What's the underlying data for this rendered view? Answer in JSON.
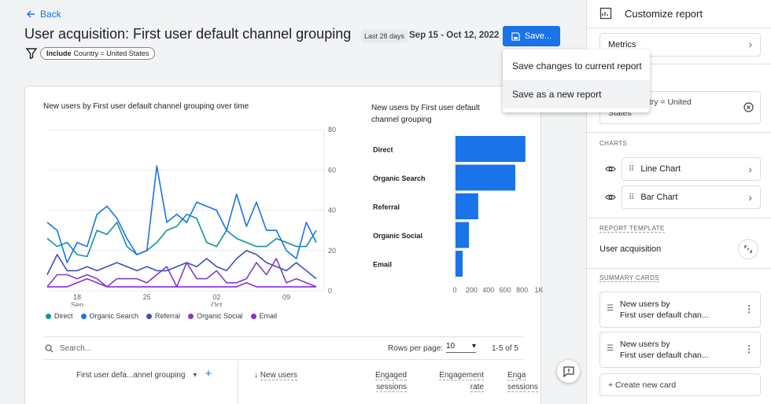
{
  "header": {
    "back_label": "Back",
    "title": "User acquisition: First user default channel grouping",
    "filter_include": "Include",
    "filter_text": "Country = United States",
    "date_label": "Last 28 days",
    "date_range": "Sep 15 - Oct 12, 2022",
    "save_label": "Save..."
  },
  "save_menu": {
    "items": [
      "Save changes to current report",
      "Save as a new report"
    ]
  },
  "line_chart": {
    "title": "New users by First user default channel grouping over time",
    "y_ticks": [
      "80",
      "60",
      "40",
      "20",
      "0"
    ],
    "x_ticks": [
      {
        "day": "18",
        "month": "Sep"
      },
      {
        "day": "25",
        "month": ""
      },
      {
        "day": "02",
        "month": "Oct"
      },
      {
        "day": "09",
        "month": ""
      }
    ]
  },
  "bar_chart": {
    "title": "New users by First user default channel grouping",
    "x_ticks": [
      "0",
      "200",
      "400",
      "600",
      "800",
      "1K"
    ]
  },
  "chart_data": [
    {
      "type": "line",
      "title": "New users by First user default channel grouping over time",
      "x": [
        "Sep 15",
        "Sep 16",
        "Sep 17",
        "Sep 18",
        "Sep 19",
        "Sep 20",
        "Sep 21",
        "Sep 22",
        "Sep 23",
        "Sep 24",
        "Sep 25",
        "Sep 26",
        "Sep 27",
        "Sep 28",
        "Sep 29",
        "Sep 30",
        "Oct 1",
        "Oct 2",
        "Oct 3",
        "Oct 4",
        "Oct 5",
        "Oct 6",
        "Oct 7",
        "Oct 8",
        "Oct 9",
        "Oct 10",
        "Oct 11",
        "Oct 12"
      ],
      "ylim": [
        0,
        80
      ],
      "series": [
        {
          "name": "Direct",
          "color": "#12939a",
          "values": [
            26,
            22,
            24,
            18,
            17,
            30,
            28,
            34,
            22,
            18,
            20,
            24,
            30,
            32,
            38,
            36,
            24,
            22,
            30,
            26,
            24,
            22,
            22,
            26,
            24,
            22,
            22,
            30
          ]
        },
        {
          "name": "Organic Search",
          "color": "#1a73e8",
          "values": [
            34,
            30,
            14,
            24,
            22,
            38,
            42,
            36,
            26,
            18,
            20,
            62,
            34,
            38,
            34,
            44,
            42,
            40,
            30,
            48,
            32,
            44,
            30,
            30,
            20,
            16,
            34,
            24
          ]
        },
        {
          "name": "Referral",
          "color": "#3f51b5",
          "values": [
            8,
            18,
            10,
            10,
            12,
            10,
            12,
            14,
            12,
            10,
            12,
            10,
            10,
            12,
            14,
            12,
            16,
            12,
            10,
            16,
            20,
            18,
            14,
            12,
            10,
            14,
            10,
            6
          ]
        },
        {
          "name": "Organic Social",
          "color": "#7e3ec3",
          "values": [
            2,
            8,
            8,
            6,
            8,
            6,
            2,
            6,
            6,
            6,
            4,
            8,
            12,
            2,
            14,
            6,
            6,
            10,
            4,
            4,
            6,
            14,
            8,
            16,
            4,
            6,
            4,
            2
          ]
        },
        {
          "name": "Email",
          "color": "#8a2be2",
          "values": [
            2,
            2,
            2,
            4,
            6,
            4,
            2,
            2,
            2,
            2,
            2,
            2,
            2,
            2,
            2,
            2,
            2,
            2,
            2,
            2,
            4,
            2,
            2,
            2,
            2,
            2,
            2,
            2
          ]
        }
      ]
    },
    {
      "type": "bar",
      "title": "New users by First user default channel grouping",
      "categories": [
        "Direct",
        "Organic Search",
        "Referral",
        "Organic Social",
        "Email"
      ],
      "values": [
        830,
        710,
        270,
        160,
        85
      ],
      "xlim": [
        0,
        1000
      ],
      "color": "#1a73e8"
    }
  ],
  "table": {
    "search_placeholder": "Search...",
    "rows_label": "Rows per page:",
    "rows_value": "10",
    "pager": "1-5 of 5",
    "dim_header": "First user defa...annel grouping",
    "columns": [
      {
        "line1": "New users",
        "line2": ""
      },
      {
        "line1": "Engaged",
        "line2": "sessions"
      },
      {
        "line1": "Engagement",
        "line2": "rate"
      },
      {
        "line1": "Enga",
        "line2": "sessions"
      }
    ]
  },
  "panel": {
    "title": "Customize report",
    "metrics_label": "Metrics",
    "filter_text_1": "ntry = United",
    "filter_text_2": "States",
    "charts_label": "CHARTS",
    "charts": [
      "Line Chart",
      "Bar Chart"
    ],
    "template_label": "REPORT TEMPLATE",
    "template_value": "User acquisition",
    "summary_label": "SUMMARY CARDS",
    "summary_cards": [
      {
        "line1": "New users by",
        "line2": "First user default chan..."
      },
      {
        "line1": "New users by",
        "line2": "First user default chan..."
      }
    ],
    "create_card": "+ Create new card"
  },
  "colors": {
    "accent": "#1a73e8",
    "bar": "#1a73e8"
  }
}
